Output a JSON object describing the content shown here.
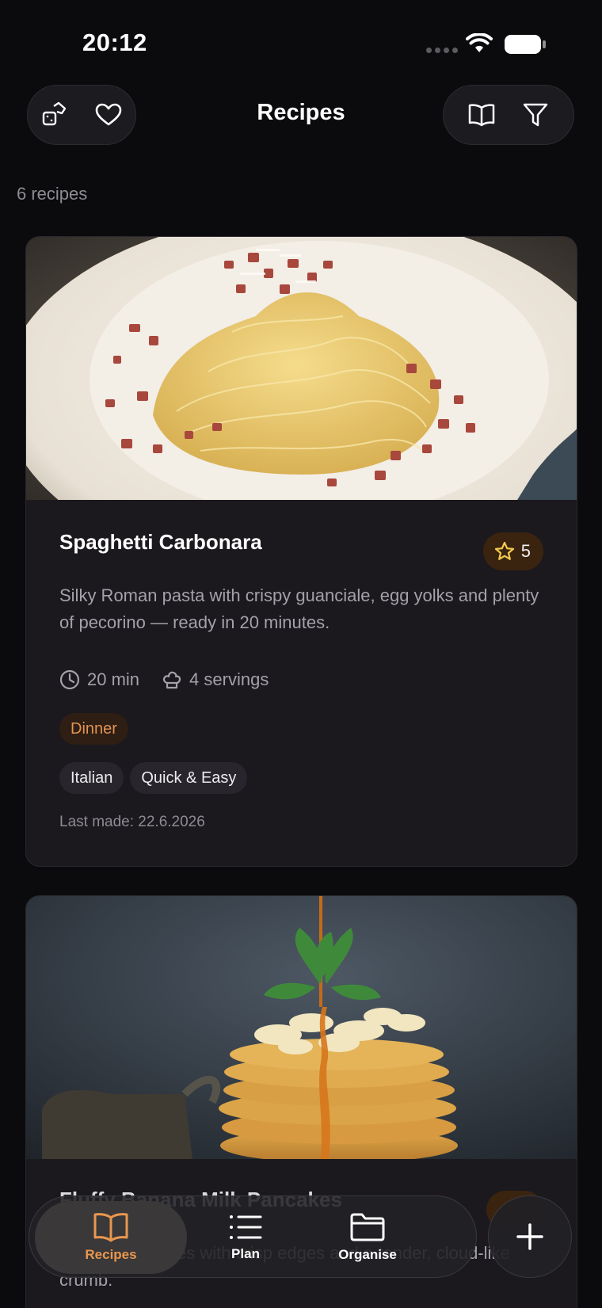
{
  "status_bar": {
    "time": "20:12"
  },
  "header": {
    "title": "Recipes",
    "left_icons": [
      "dice-icon",
      "heart-icon"
    ],
    "right_icons": [
      "book-icon",
      "filter-icon"
    ]
  },
  "recipe_count": "6 recipes",
  "recipes": [
    {
      "title": "Spaghetti Carbonara",
      "rating": "5",
      "description": "Silky Roman pasta with crispy guanciale, egg yolks and plenty of pecorino — ready in 20 minutes.",
      "time": "20 min",
      "servings": "4 servings",
      "meal_type": "Dinner",
      "tags": [
        "Italian",
        "Quick & Easy"
      ],
      "last_made": "Last made: 22.6.2026"
    },
    {
      "title": "Fluffy Banana Milk Pancakes",
      "description": "Golden pancakes with crisp edges and a tender, cloud-like crumb."
    }
  ],
  "tab_bar": {
    "tabs": [
      {
        "label": "Recipes",
        "icon": "book-icon",
        "active": true
      },
      {
        "label": "Plan",
        "icon": "list-icon",
        "active": false
      },
      {
        "label": "Organise",
        "icon": "folder-icon",
        "active": false
      }
    ],
    "add_icon": "plus-icon"
  },
  "colors": {
    "background": "#0b0a0d",
    "card": "#1b191e",
    "accent": "#e8974f",
    "star": "#f2c94c"
  }
}
